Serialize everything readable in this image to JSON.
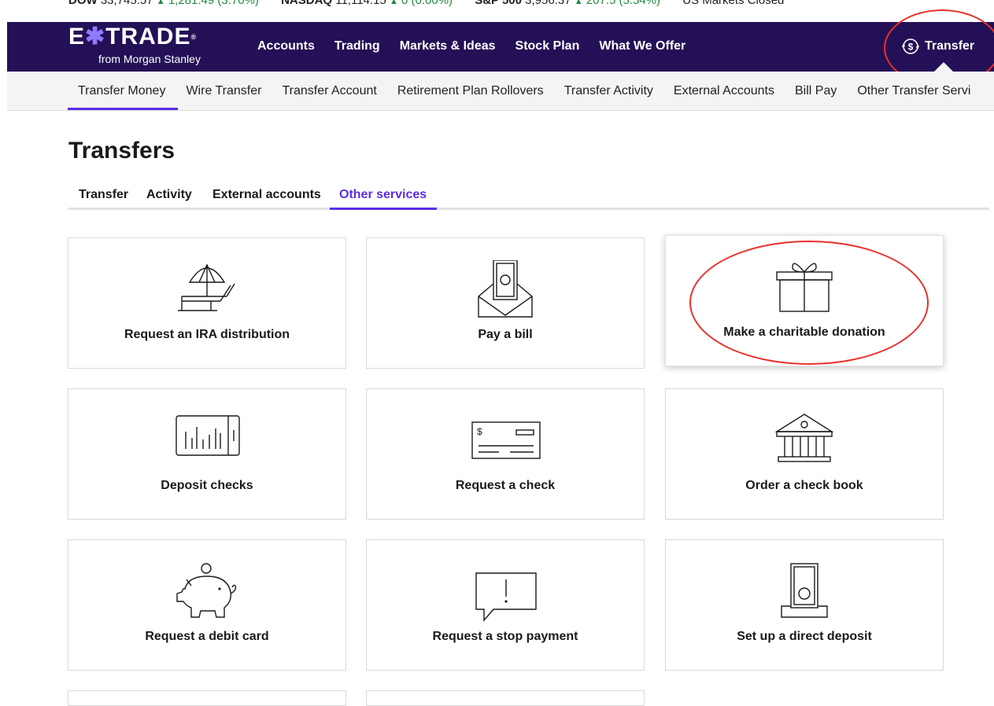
{
  "ticker": [
    {
      "symbol": "DOW",
      "value": "33,745.57",
      "change": "1,281.49 (3.70%)"
    },
    {
      "symbol": "NASDAQ",
      "value": "11,114.15",
      "change": "0 (0.00%)"
    },
    {
      "symbol": "S&P 500",
      "value": "3,956.37",
      "change": "207.5 (5.54%)"
    },
    {
      "symbol": "",
      "value": "US Markets Closed",
      "change": ""
    }
  ],
  "brand": {
    "logo_text": "E*TRADE",
    "logo_sub": "from Morgan Stanley",
    "nav_bg": "#241056",
    "accent": "#5b2ee6",
    "annotation": "#e8312a"
  },
  "main_nav": {
    "items": [
      "Accounts",
      "Trading",
      "Markets & Ideas",
      "Stock Plan",
      "What We Offer"
    ],
    "transfer_label": "Transfer"
  },
  "sub_nav": {
    "items": [
      "Transfer Money",
      "Wire Transfer",
      "Transfer Account",
      "Retirement Plan Rollovers",
      "Transfer Activity",
      "External Accounts",
      "Bill Pay",
      "Other Transfer Servi"
    ]
  },
  "page": {
    "title": "Transfers",
    "tabs": [
      "Transfer",
      "Activity",
      "External accounts",
      "Other services"
    ],
    "active_tab": "Other services"
  },
  "cards": [
    {
      "label": "Request an IRA distribution",
      "icon": "beach-chair-icon"
    },
    {
      "label": "Pay a bill",
      "icon": "envelope-money-icon"
    },
    {
      "label": "Make a charitable donation",
      "icon": "gift-icon"
    },
    {
      "label": "Deposit checks",
      "icon": "mobile-check-icon"
    },
    {
      "label": "Request a check",
      "icon": "check-icon"
    },
    {
      "label": "Order a check book",
      "icon": "bank-icon"
    },
    {
      "label": "Request a debit card",
      "icon": "piggy-bank-icon"
    },
    {
      "label": "Request a stop payment",
      "icon": "alert-message-icon"
    },
    {
      "label": "Set up a direct deposit",
      "icon": "deposit-icon"
    }
  ]
}
